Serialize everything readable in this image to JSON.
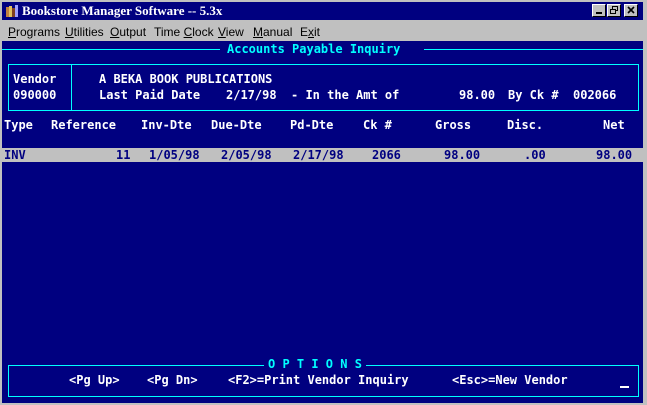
{
  "window": {
    "title": "Bookstore Manager Software -- 5.3x"
  },
  "menu": [
    {
      "pre": "",
      "u": "P",
      "post": "rograms"
    },
    {
      "pre": "",
      "u": "U",
      "post": "tilities"
    },
    {
      "pre": "",
      "u": "O",
      "post": "utput"
    },
    {
      "pre": "Time ",
      "u": "C",
      "post": "lock"
    },
    {
      "pre": "",
      "u": "V",
      "post": "iew"
    },
    {
      "pre": "",
      "u": "M",
      "post": "anual"
    },
    {
      "pre": "E",
      "u": "x",
      "post": "it"
    }
  ],
  "screen": {
    "heading": "Accounts Payable Inquiry",
    "vendor": {
      "label": "Vendor",
      "number": "090000",
      "name": "A BEKA BOOK PUBLICATIONS",
      "last_paid_label": "Last Paid Date",
      "last_paid_date": "2/17/98",
      "amount_label": "- In the Amt of",
      "amount": "98.00",
      "check_label": "By Ck #",
      "check_no": "002066"
    },
    "columns": {
      "type": "Type",
      "reference": "Reference",
      "inv_dte": "Inv-Dte",
      "due_dte": "Due-Dte",
      "pd_dte": "Pd-Dte",
      "ck": "Ck #",
      "gross": "Gross",
      "disc": "Disc.",
      "net": "Net"
    },
    "rows": [
      {
        "type": "INV",
        "reference": "11",
        "inv_dte": "1/05/98",
        "due_dte": "2/05/98",
        "pd_dte": "2/17/98",
        "ck": "2066",
        "gross": "98.00",
        "disc": ".00",
        "net": "98.00"
      }
    ],
    "options": {
      "title": "O P T I O N S",
      "pg_up": "<Pg Up>",
      "pg_dn": "<Pg Dn>",
      "print": "<F2>=Print Vendor Inquiry",
      "new_vendor": "<Esc>=New Vendor"
    }
  },
  "colors": {
    "title_bar": "#000080",
    "screen_bg": "#000080",
    "frame": "#00ffff",
    "highlight_row": "#c0c0c0"
  }
}
